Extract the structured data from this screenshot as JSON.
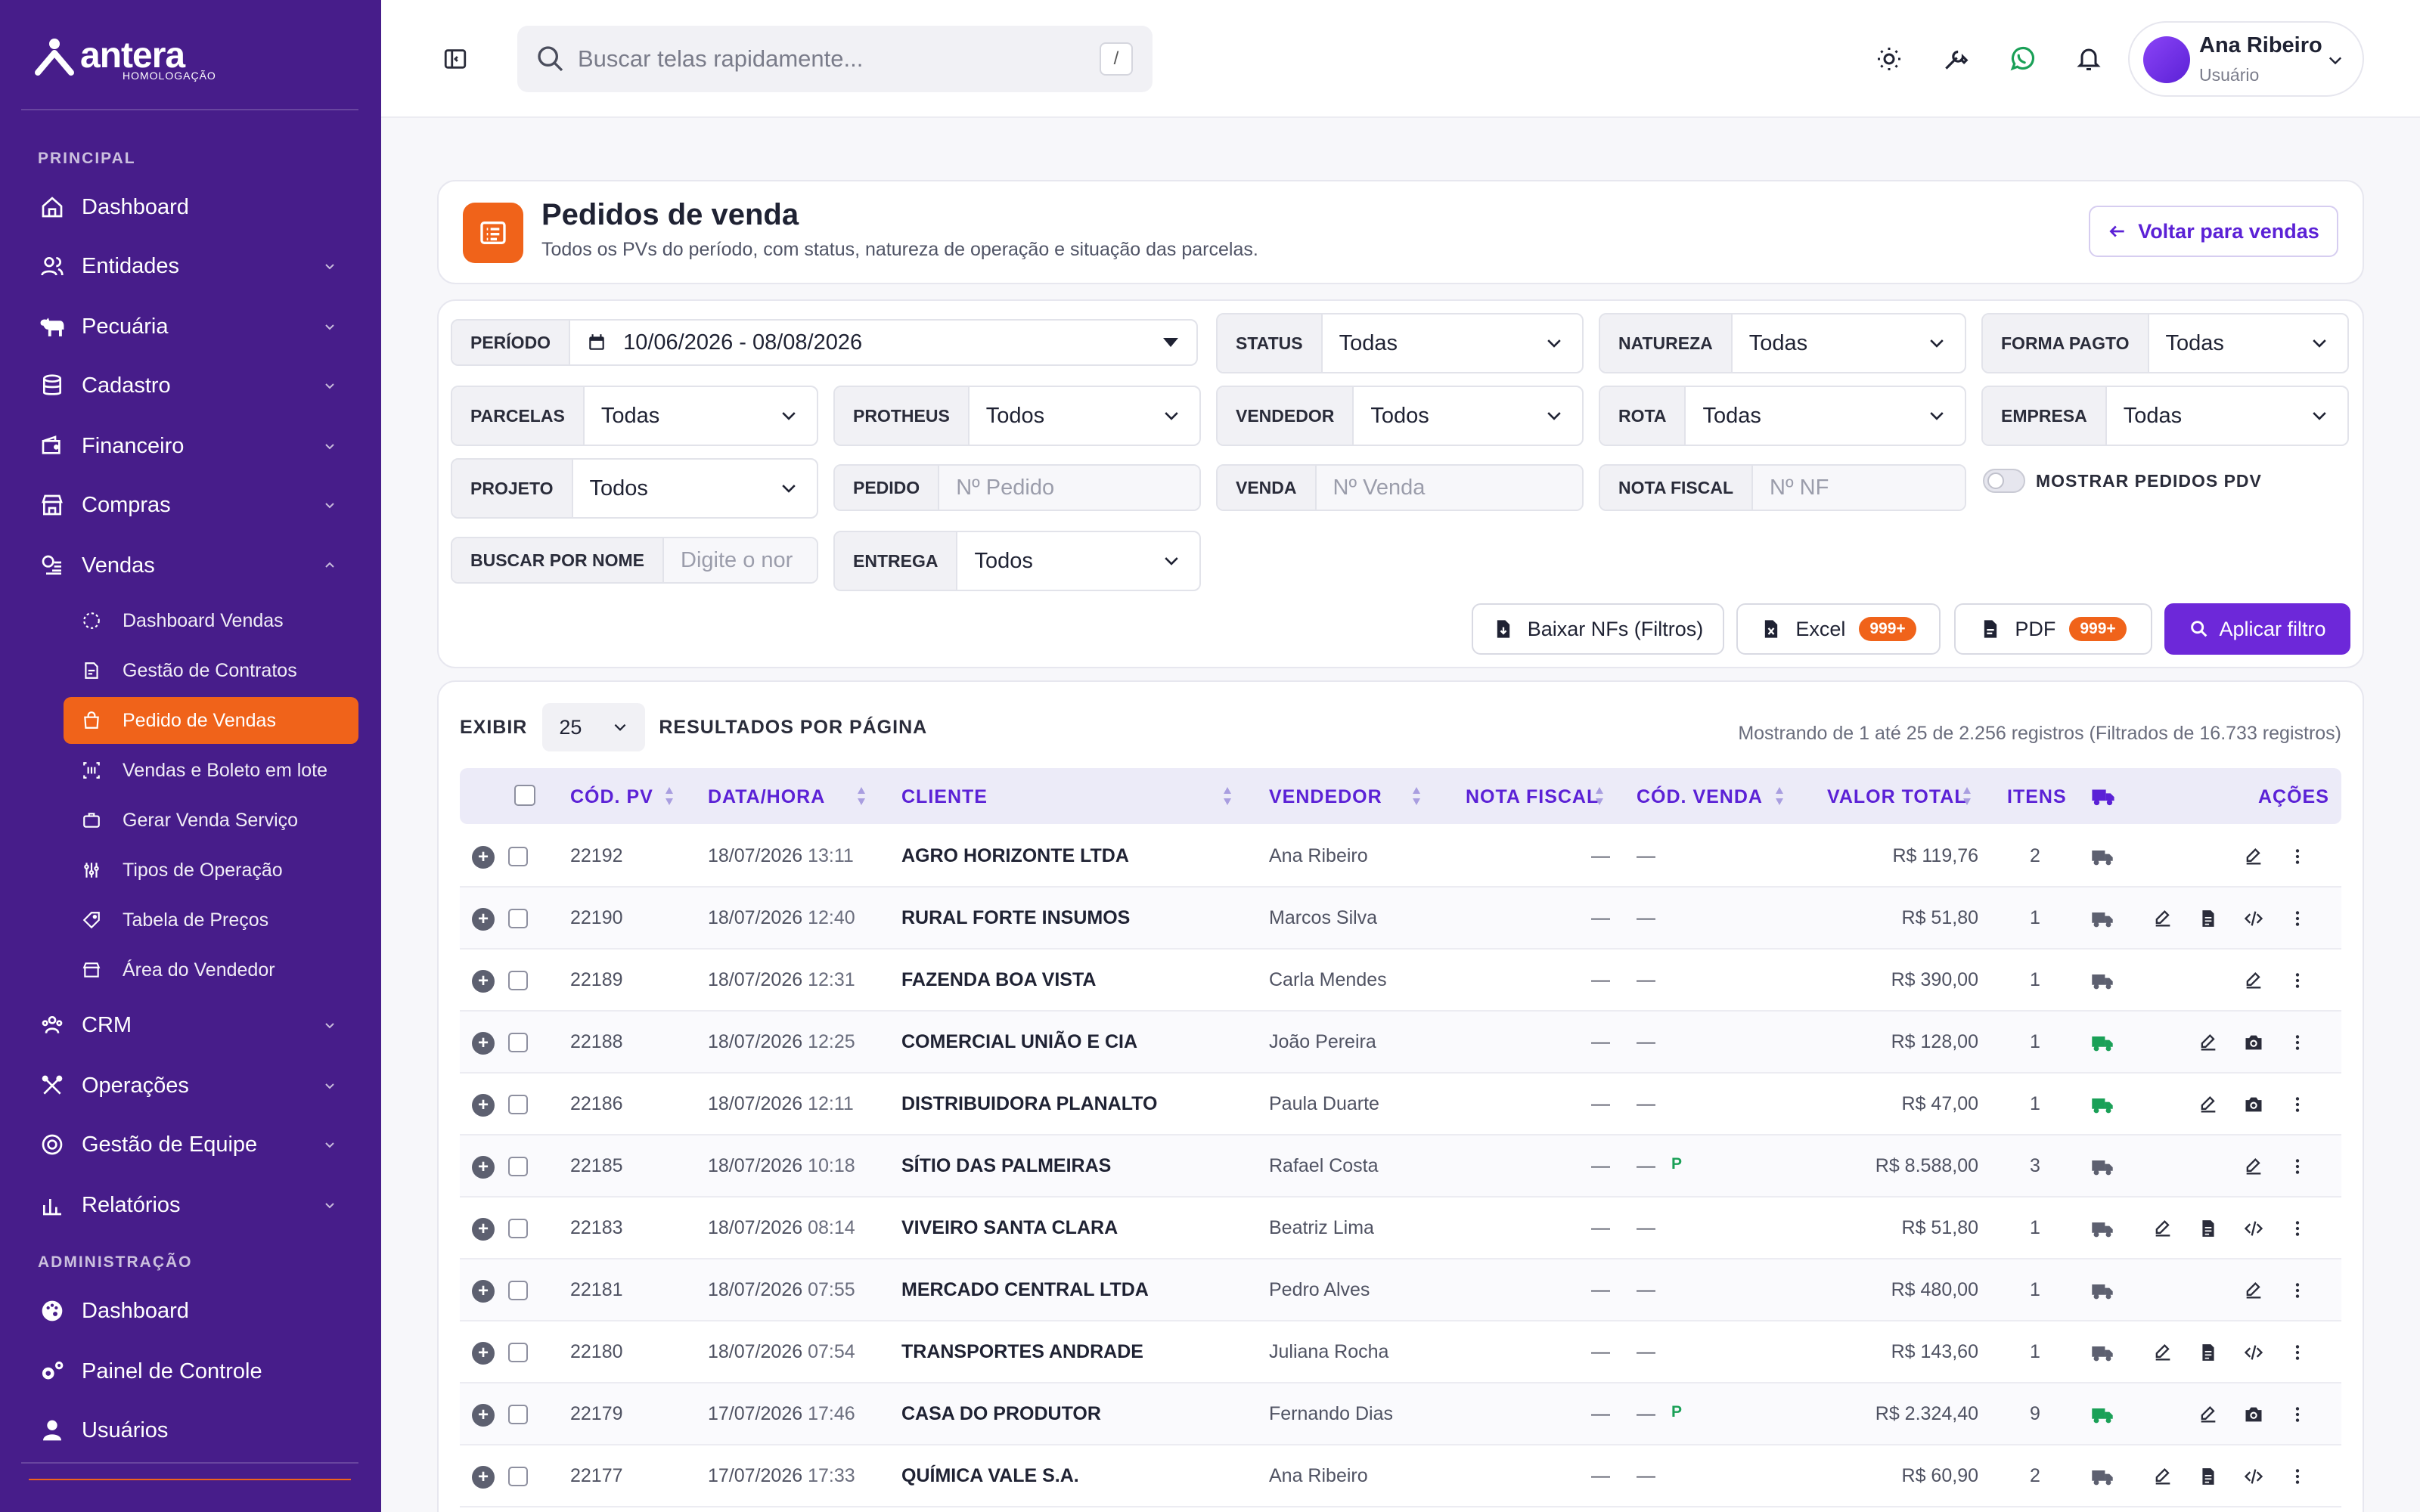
{
  "brand": {
    "name": "antera",
    "env": "HOMOLOGAÇÃO"
  },
  "colors": {
    "sidebar": "#471d8a",
    "accent_orange": "#f0631a",
    "primary": "#6d28d9",
    "header_purple": "#5b21d6",
    "delivered_green": "#1aa057"
  },
  "sidebar": {
    "section_principal": "PRINCIPAL",
    "section_admin": "ADMINISTRAÇÃO",
    "items": [
      {
        "label": "Dashboard",
        "icon": "home-icon"
      },
      {
        "label": "Entidades",
        "icon": "users-icon"
      },
      {
        "label": "Pecuária",
        "icon": "cow-icon"
      },
      {
        "label": "Cadastro",
        "icon": "database-icon"
      },
      {
        "label": "Financeiro",
        "icon": "wallet-icon"
      },
      {
        "label": "Compras",
        "icon": "store-icon"
      },
      {
        "label": "Vendas",
        "icon": "coins-icon"
      }
    ],
    "vendas_sub": [
      {
        "label": "Dashboard Vendas"
      },
      {
        "label": "Gestão de Contratos"
      },
      {
        "label": "Pedido de Vendas",
        "active": true
      },
      {
        "label": "Vendas e Boleto em lote"
      },
      {
        "label": "Gerar Venda Serviço"
      },
      {
        "label": "Tipos de Operação"
      },
      {
        "label": "Tabela de Preços"
      },
      {
        "label": "Área do Vendedor"
      }
    ],
    "items_after": [
      {
        "label": "CRM"
      },
      {
        "label": "Operações"
      },
      {
        "label": "Gestão de Equipe"
      },
      {
        "label": "Relatórios"
      }
    ],
    "admin_items": [
      {
        "label": "Dashboard"
      },
      {
        "label": "Painel de Controle"
      },
      {
        "label": "Usuários"
      }
    ]
  },
  "header": {
    "search_placeholder": "Buscar telas rapidamente...",
    "search_shortcut": "/",
    "user_name": "Ana Ribeiro",
    "user_role": "Usuário"
  },
  "page": {
    "title": "Pedidos de venda",
    "subtitle": "Todos os PVs do período, com status, natureza de operação e situação das parcelas.",
    "back_button": "Voltar para vendas"
  },
  "filters": {
    "periodo": {
      "label": "PERÍODO",
      "value": "10/06/2026 - 08/08/2026"
    },
    "status": {
      "label": "STATUS",
      "value": "Todas"
    },
    "natureza": {
      "label": "NATUREZA",
      "value": "Todas"
    },
    "forma_pagto": {
      "label": "FORMA PAGTO",
      "value": "Todas"
    },
    "parcelas": {
      "label": "PARCELAS",
      "value": "Todas"
    },
    "protheus": {
      "label": "PROTHEUS",
      "value": "Todos"
    },
    "vendedor": {
      "label": "VENDEDOR",
      "value": "Todos"
    },
    "rota": {
      "label": "ROTA",
      "value": "Todas"
    },
    "empresa": {
      "label": "EMPRESA",
      "value": "Todas"
    },
    "projeto": {
      "label": "PROJETO",
      "value": "Todos"
    },
    "pedido": {
      "label": "PEDIDO",
      "placeholder": "Nº Pedido"
    },
    "venda": {
      "label": "VENDA",
      "placeholder": "Nº Venda"
    },
    "nota_fiscal": {
      "label": "NOTA FISCAL",
      "placeholder": "Nº NF"
    },
    "mostrar_pdv": {
      "label": "MOSTRAR PEDIDOS PDV",
      "on": false
    },
    "buscar_nome": {
      "label": "BUSCAR POR NOME",
      "placeholder": "Digite o nor"
    },
    "entrega": {
      "label": "ENTREGA",
      "value": "Todos"
    }
  },
  "actions": {
    "baixar_nfs": "Baixar NFs (Filtros)",
    "excel": "Excel",
    "excel_badge": "999+",
    "pdf": "PDF",
    "pdf_badge": "999+",
    "apply": "Aplicar filtro"
  },
  "table": {
    "show_label": "EXIBIR",
    "page_size": "25",
    "results_label": "RESULTADOS POR PÁGINA",
    "showing": "Mostrando de 1 até 25 de 2.256 registros (Filtrados de 16.733 registros)",
    "columns": {
      "cod_pv": "CÓD. PV",
      "data_hora": "DATA/HORA",
      "cliente": "CLIENTE",
      "vendedor": "VENDEDOR",
      "nota_fiscal": "NOTA FISCAL",
      "cod_venda": "CÓD. VENDA",
      "valor_total": "VALOR TOTAL",
      "itens": "ITENS",
      "acoes": "AÇÕES"
    },
    "rows": [
      {
        "pv": "22192",
        "date": "18/07/2026",
        "time": "13:11",
        "cliente": "AGRO HORIZONTE LTDA",
        "vendedor": "Ana Ribeiro",
        "nf": "—",
        "venda": "—",
        "flag": "",
        "valor": "R$ 119,76",
        "itens": "2",
        "delivered": false,
        "actions": [
          "edit",
          "more"
        ]
      },
      {
        "pv": "22190",
        "date": "18/07/2026",
        "time": "12:40",
        "cliente": "RURAL FORTE INSUMOS",
        "vendedor": "Marcos Silva",
        "nf": "—",
        "venda": "—",
        "flag": "",
        "valor": "R$ 51,80",
        "itens": "1",
        "delivered": false,
        "actions": [
          "edit",
          "doc",
          "code",
          "more"
        ]
      },
      {
        "pv": "22189",
        "date": "18/07/2026",
        "time": "12:31",
        "cliente": "FAZENDA BOA VISTA",
        "vendedor": "Carla Mendes",
        "nf": "—",
        "venda": "—",
        "flag": "",
        "valor": "R$ 390,00",
        "itens": "1",
        "delivered": false,
        "actions": [
          "edit",
          "more"
        ]
      },
      {
        "pv": "22188",
        "date": "18/07/2026",
        "time": "12:25",
        "cliente": "COMERCIAL UNIÃO E CIA",
        "vendedor": "João Pereira",
        "nf": "—",
        "venda": "—",
        "flag": "",
        "valor": "R$ 128,00",
        "itens": "1",
        "delivered": true,
        "actions": [
          "edit",
          "camera",
          "more"
        ]
      },
      {
        "pv": "22186",
        "date": "18/07/2026",
        "time": "12:11",
        "cliente": "DISTRIBUIDORA PLANALTO",
        "vendedor": "Paula Duarte",
        "nf": "—",
        "venda": "—",
        "flag": "",
        "valor": "R$ 47,00",
        "itens": "1",
        "delivered": true,
        "actions": [
          "edit",
          "camera",
          "more"
        ]
      },
      {
        "pv": "22185",
        "date": "18/07/2026",
        "time": "10:18",
        "cliente": "SÍTIO DAS PALMEIRAS",
        "vendedor": "Rafael Costa",
        "nf": "—",
        "venda": "—",
        "flag": "P",
        "valor": "R$ 8.588,00",
        "itens": "3",
        "delivered": false,
        "actions": [
          "edit",
          "more"
        ]
      },
      {
        "pv": "22183",
        "date": "18/07/2026",
        "time": "08:14",
        "cliente": "VIVEIRO SANTA CLARA",
        "vendedor": "Beatriz Lima",
        "nf": "—",
        "venda": "—",
        "flag": "",
        "valor": "R$ 51,80",
        "itens": "1",
        "delivered": false,
        "actions": [
          "edit",
          "doc",
          "code",
          "more"
        ]
      },
      {
        "pv": "22181",
        "date": "18/07/2026",
        "time": "07:55",
        "cliente": "MERCADO CENTRAL LTDA",
        "vendedor": "Pedro Alves",
        "nf": "—",
        "venda": "—",
        "flag": "",
        "valor": "R$ 480,00",
        "itens": "1",
        "delivered": false,
        "actions": [
          "edit",
          "more"
        ]
      },
      {
        "pv": "22180",
        "date": "18/07/2026",
        "time": "07:54",
        "cliente": "TRANSPORTES ANDRADE",
        "vendedor": "Juliana Rocha",
        "nf": "—",
        "venda": "—",
        "flag": "",
        "valor": "R$ 143,60",
        "itens": "1",
        "delivered": false,
        "actions": [
          "edit",
          "doc",
          "code",
          "more"
        ]
      },
      {
        "pv": "22179",
        "date": "17/07/2026",
        "time": "17:46",
        "cliente": "CASA DO PRODUTOR",
        "vendedor": "Fernando Dias",
        "nf": "—",
        "venda": "—",
        "flag": "P",
        "valor": "R$ 2.324,40",
        "itens": "9",
        "delivered": true,
        "actions": [
          "edit",
          "camera",
          "more"
        ]
      },
      {
        "pv": "22177",
        "date": "17/07/2026",
        "time": "17:33",
        "cliente": "QUÍMICA VALE S.A.",
        "vendedor": "Ana Ribeiro",
        "nf": "—",
        "venda": "—",
        "flag": "",
        "valor": "R$ 60,90",
        "itens": "2",
        "delivered": false,
        "actions": [
          "edit",
          "doc",
          "code",
          "more"
        ]
      }
    ]
  }
}
